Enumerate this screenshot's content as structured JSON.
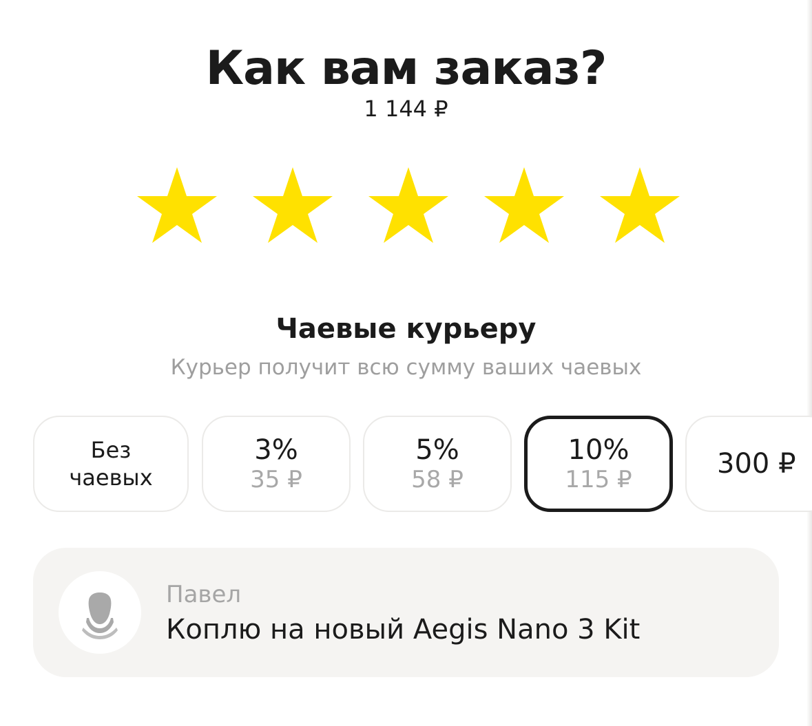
{
  "header": {
    "title": "Как вам заказ?",
    "order_total": "1 144 ₽"
  },
  "rating": {
    "stars_filled": 5,
    "stars_total": 5,
    "star_color": "#FFE100"
  },
  "tips": {
    "title": "Чаевые курьеру",
    "subtitle": "Курьер получит всю сумму ваших чаевых",
    "options": [
      {
        "main": "Без\nчаевых",
        "sub": ""
      },
      {
        "main": "3%",
        "sub": "35 ₽"
      },
      {
        "main": "5%",
        "sub": "58 ₽"
      },
      {
        "main": "10%",
        "sub": "115 ₽"
      },
      {
        "main": "300 ₽",
        "sub": ""
      }
    ],
    "selected_index": 3
  },
  "courier": {
    "name": "Павел",
    "message": "Коплю на новый Aegis Nano 3 Kit",
    "avatar_icon": "person-icon"
  },
  "colors": {
    "text_primary": "#1B1B1B",
    "text_secondary": "#9E9E9E",
    "card_background": "#F5F4F2",
    "selected_border": "#1B1B1B"
  }
}
